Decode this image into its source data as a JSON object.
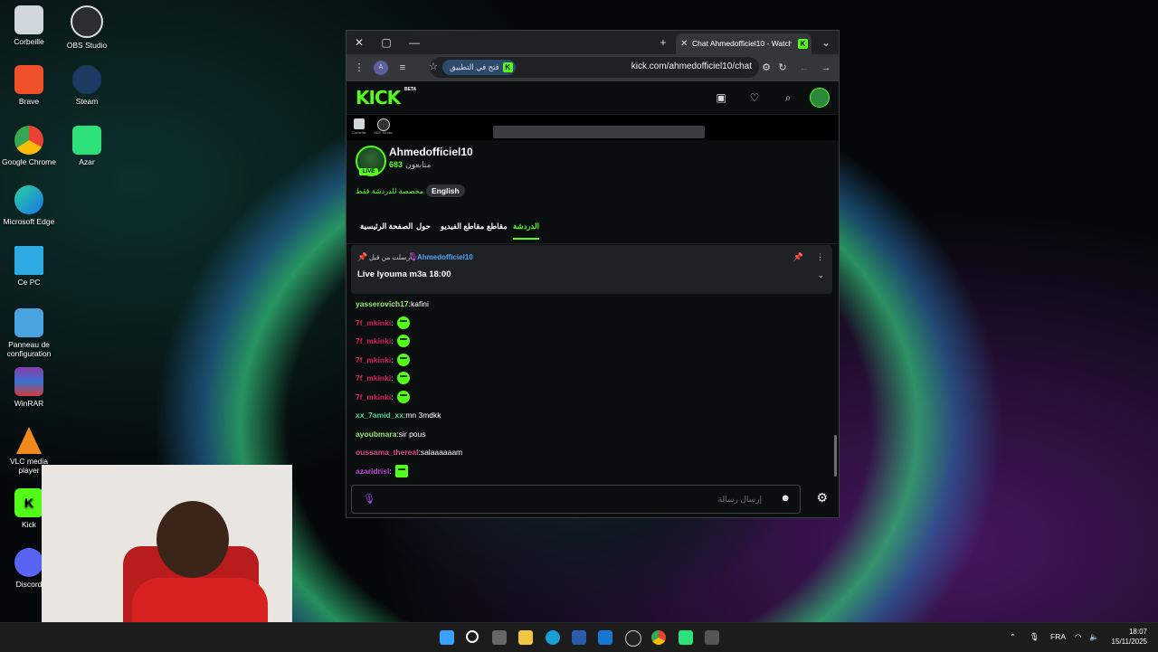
{
  "desktop": {
    "icons": [
      {
        "label": "Corbeille",
        "icon": "recycle-bin-icon"
      },
      {
        "label": "OBS Studio",
        "icon": "obs-icon"
      },
      {
        "label": "Brave",
        "icon": "brave-icon"
      },
      {
        "label": "Steam",
        "icon": "steam-icon"
      },
      {
        "label": "Google Chrome",
        "icon": "chrome-icon"
      },
      {
        "label": "Azar",
        "icon": "azar-icon"
      },
      {
        "label": "Microsoft Edge",
        "icon": "edge-icon"
      },
      {
        "label": "Ce PC",
        "icon": "monitor-icon"
      },
      {
        "label": "Panneau de configuration",
        "icon": "control-panel-icon"
      },
      {
        "label": "WinRAR",
        "icon": "winrar-icon"
      },
      {
        "label": "VLC media player",
        "icon": "vlc-icon"
      },
      {
        "label": "Kick",
        "icon": "kick-icon"
      },
      {
        "label": "Discord",
        "icon": "discord-icon"
      }
    ]
  },
  "browser": {
    "tab_title": "Chat Ahmedofficiel10 - Watch",
    "url": "kick.com/ahmedofficiel10/chat",
    "open_in_app": "فتح في التطبيق"
  },
  "kick": {
    "logo": "KICK",
    "beta": "BETA",
    "preview": {
      "label1": "Corbeille",
      "label2": "OBS Studio"
    },
    "channel": {
      "name": "Ahmedofficiel10",
      "followers": "683",
      "followers_label": "متابعون",
      "live_badge": "LIVE",
      "chat_only": "مخصصة للدردشة فقط",
      "language": "English"
    },
    "tabs": [
      "الصفحة الرئيسية",
      "حول",
      "مقاطع الفيديو",
      "مقاطع",
      "الدردشة"
    ],
    "pinned": {
      "sent_by": "أرسلت من قبل",
      "user": "Ahmedofficiel10",
      "message": "Live lyouma m3a 18:00"
    },
    "messages": [
      {
        "user": "yasserovich17",
        "color": "#9be86b",
        "text": "kafini",
        "emote": false
      },
      {
        "user": "7f_mkinki",
        "color": "#d6205b",
        "text": "",
        "emote": true
      },
      {
        "user": "7f_mkinki",
        "color": "#d6205b",
        "text": "",
        "emote": true
      },
      {
        "user": "7f_mkinki",
        "color": "#d6205b",
        "text": "",
        "emote": true
      },
      {
        "user": "7f_mkinki",
        "color": "#d6205b",
        "text": "",
        "emote": true
      },
      {
        "user": "7f_mkinki",
        "color": "#d6205b",
        "text": "",
        "emote": true
      },
      {
        "user": "xx_7amid_xx",
        "color": "#4fd19a",
        "text": "mn 3mdkk",
        "emote": false
      },
      {
        "user": "ayoubmara",
        "color": "#9be86b",
        "text": "sir pous",
        "emote": false
      },
      {
        "user": "oussama_thereal",
        "color": "#e04a8a",
        "text": "salaaaaaam",
        "emote": false
      },
      {
        "user": "azaridrisi",
        "color": "#c04adf",
        "text": "",
        "emote": true
      }
    ],
    "input_placeholder": "إرسال رسالة"
  },
  "taskbar": {
    "lang": "FRA",
    "time": "18:07",
    "date": "15/11/2025"
  }
}
